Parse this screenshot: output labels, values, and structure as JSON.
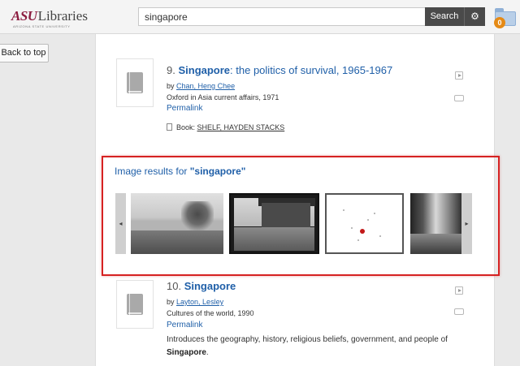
{
  "header": {
    "logo_asu": "ASU",
    "logo_libraries": "Libraries",
    "logo_sub": "ARIZONA STATE UNIVERSITY",
    "search_value": "singapore",
    "search_button": "Search",
    "gear_icon": "gear-icon",
    "folder_badge": "0"
  },
  "left": {
    "back_to_top": "Back to top"
  },
  "results": [
    {
      "number": "9.",
      "title_bold": "Singapore",
      "title_rest": ": the politics of survival, 1965-1967",
      "by_label": "by",
      "author": "Chan, Heng Chee",
      "publication": "Oxford in Asia current affairs, 1971",
      "permalink": "Permalink",
      "holding_type": "Book:",
      "holding_location": "SHELF, HAYDEN STACKS"
    },
    {
      "number": "10.",
      "title_bold": "Singapore",
      "by_label": "by",
      "author": "Layton, Lesley",
      "publication": "Cultures of the world, 1990",
      "permalink": "Permalink",
      "description": "Introduces the geography, history, religious beliefs, government, and people of",
      "description_bold": "Singapore",
      "description_end": "."
    }
  ],
  "image_results": {
    "heading_prefix": "Image results for",
    "query": "\"singapore\"",
    "prev_arrow": "◂",
    "next_arrow": "▸"
  }
}
